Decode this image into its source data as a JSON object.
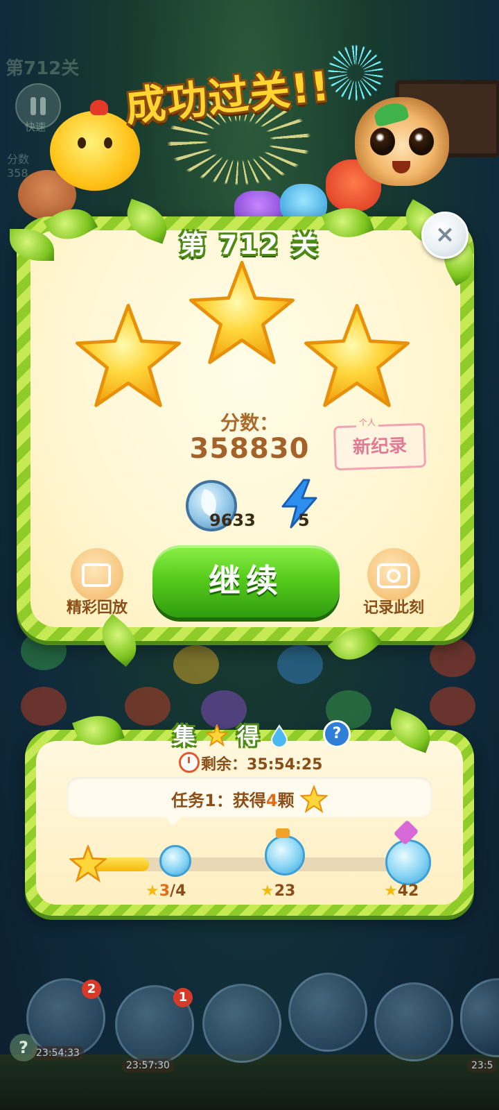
{
  "hud": {
    "level": "第712关",
    "speed_label": "快速",
    "score_label": "分数",
    "score_partial": "358"
  },
  "banner": {
    "text": "成功过关!!"
  },
  "result": {
    "level_title": "第 712 关",
    "stars_earned": 3,
    "stars_total": 3,
    "score_label": "分数：",
    "score_value": "358830",
    "record_small": "个人",
    "record_label": "新纪录",
    "coins": "9633",
    "energy": "5",
    "replay_label": "精彩回放",
    "continue_label": "继续",
    "capture_label": "记录此刻",
    "close_symbol": "×"
  },
  "event": {
    "title_left": "集",
    "title_right": "得",
    "help": "?",
    "remaining_label": "剩余：",
    "remaining_time": "35:54:25",
    "task_prefix": "任务",
    "task_num": "1",
    "task_mid": "：获得",
    "task_count": "4",
    "task_suffix": "颗",
    "progress_fraction": 0.19,
    "milestones": [
      {
        "progress": "3",
        "target": "/4"
      },
      {
        "target": "23"
      },
      {
        "target": "42"
      }
    ]
  },
  "boosters": [
    {
      "badge": "2",
      "time": "23:54:33"
    },
    {
      "badge": "1",
      "time": "23:57:30"
    },
    {
      "badge": "",
      "time": ""
    },
    {
      "badge": "",
      "time": ""
    },
    {
      "badge": "",
      "time": ""
    },
    {
      "badge": "",
      "time": "23:5"
    }
  ],
  "colors": {
    "gold": "#ffd531",
    "vine_green": "#8fcc2a",
    "panel_cream": "#fff6d2",
    "continue_green": "#58cc1c",
    "text_brown": "#a4622a"
  }
}
